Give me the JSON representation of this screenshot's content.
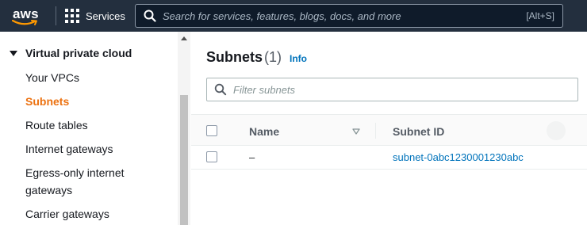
{
  "topnav": {
    "logo_text": "aws",
    "services_label": "Services",
    "search": {
      "placeholder": "Search for services, features, blogs, docs, and more",
      "value": "",
      "shortcut": "[Alt+S]"
    }
  },
  "sidebar": {
    "section_title": "Virtual private cloud",
    "items": [
      {
        "label": "Your VPCs",
        "active": false
      },
      {
        "label": "Subnets",
        "active": true
      },
      {
        "label": "Route tables",
        "active": false
      },
      {
        "label": "Internet gateways",
        "active": false
      },
      {
        "label": "Egress-only internet",
        "active": false
      },
      {
        "label": "gateways",
        "active": false
      },
      {
        "label": "Carrier gateways",
        "active": false
      }
    ]
  },
  "main": {
    "title": "Subnets",
    "count": "(1)",
    "info_label": "Info",
    "filter": {
      "placeholder": "Filter subnets",
      "value": ""
    },
    "table": {
      "columns": [
        "Name",
        "Subnet ID"
      ],
      "rows": [
        {
          "name": "–",
          "subnet_id": "subnet-0abc1230001230abc"
        }
      ]
    }
  },
  "colors": {
    "nav_bg": "#232f3e",
    "active_link": "#ec7211",
    "link": "#0073bb"
  }
}
